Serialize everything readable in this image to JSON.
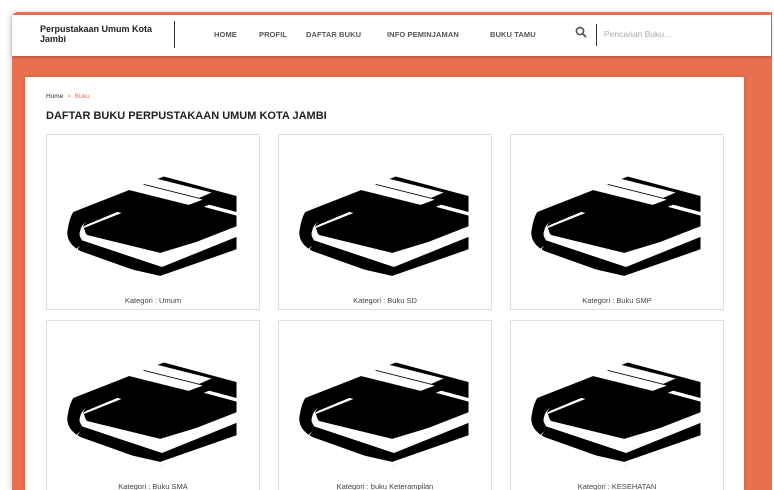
{
  "header": {
    "brand": "Perpustakaan Umum Kota Jambi",
    "nav_items": [
      {
        "label": "HOME"
      },
      {
        "label": "PROFIL"
      },
      {
        "label": "DAFTAR BUKU"
      },
      {
        "label": "INFO PEMINJAMAN"
      },
      {
        "label": "BUKU TAMU"
      }
    ],
    "search": {
      "placeholder": "Pencarian Buku...",
      "value": ""
    }
  },
  "breadcrumb": {
    "home": "Home",
    "separator": ">",
    "current": "Buku"
  },
  "page_title": "DAFTAR BUKU PERPUSTAKAAN UMUM KOTA JAMBI",
  "categories": [
    {
      "label": "Kategori : Umum",
      "icon": "book-stack-icon"
    },
    {
      "label": "Kategori : Buku SD",
      "icon": "book-stack-icon"
    },
    {
      "label": "Kategori : Buku SMP",
      "icon": "book-stack-icon"
    },
    {
      "label": "Kategori : Buku SMA",
      "icon": "book-stack-icon"
    },
    {
      "label": "Kategori : buku Keterampilan",
      "icon": "book-stack-icon"
    },
    {
      "label": "Kategori : KESEHATAN",
      "icon": "book-stack-icon"
    }
  ],
  "colors": {
    "frame": "#e8704f",
    "accent": "#e8704f",
    "text": "#222222"
  }
}
